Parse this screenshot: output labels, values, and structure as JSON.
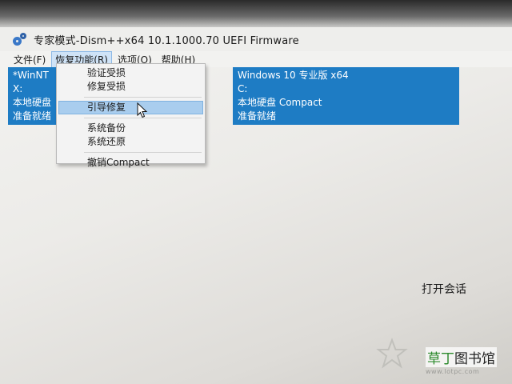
{
  "window": {
    "title": "专家模式-Dism++x64 10.1.1000.70 UEFI Firmware",
    "icon": "gears-icon"
  },
  "menubar": {
    "items": [
      {
        "label": "文件(F)"
      },
      {
        "label": "恢复功能(R)",
        "active": true
      },
      {
        "label": "选项(O)"
      },
      {
        "label": "帮助(H)"
      }
    ]
  },
  "systems": [
    {
      "name": "*WinNT",
      "drive": "X:",
      "disk": "本地硬盘",
      "status": "准备就绪"
    },
    {
      "name": "Windows 10 专业版 x64",
      "drive": "C:",
      "disk": "本地硬盘 Compact",
      "status": "准备就绪"
    }
  ],
  "dropdown": {
    "items": [
      {
        "label": "验证受损"
      },
      {
        "label": "修复受损"
      },
      {
        "label": "引导修复",
        "hover": true
      },
      {
        "label": "系统备份"
      },
      {
        "label": "系统还原"
      },
      {
        "label": "撤销Compact"
      }
    ]
  },
  "status": {
    "text": "打开会话"
  },
  "watermark": {
    "site_name": "草丁图书馆",
    "site_name_highlight": "草丁",
    "site_name_rest": "图书馆",
    "url": "www.lotpc.com"
  },
  "colors": {
    "panel": "#1e7cc4",
    "highlight": "#a9cdee",
    "accent_green": "#2d8a2d"
  }
}
